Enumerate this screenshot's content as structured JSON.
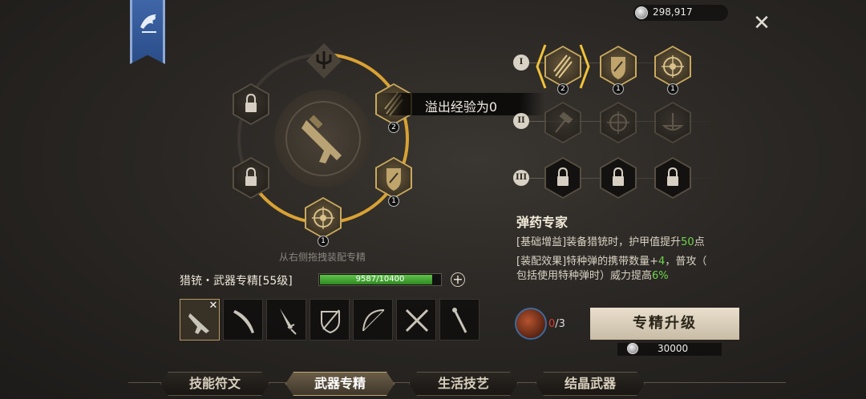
{
  "currency": {
    "icon": "silver-coin-icon",
    "value": "298,917"
  },
  "close_label": "✕",
  "ring": {
    "overflow_text": "溢出经验为0",
    "drag_hint": "从右侧拖拽装配专精",
    "slots": [
      {
        "id": "top",
        "icon": "trident-icon",
        "locked": false,
        "count": ""
      },
      {
        "id": "top-right",
        "icon": "arrows-icon",
        "locked": false,
        "count": "2"
      },
      {
        "id": "bottom-right",
        "icon": "shield-icon",
        "locked": false,
        "count": "1"
      },
      {
        "id": "bottom",
        "icon": "target-icon",
        "locked": false,
        "count": "1"
      },
      {
        "id": "bottom-left",
        "icon": "lock-icon",
        "locked": true
      },
      {
        "id": "top-left",
        "icon": "lock-icon",
        "locked": true
      }
    ]
  },
  "weapon": {
    "name": "猎铳・武器专精[55级]",
    "xp_text": "9587/10400",
    "xp_fraction": 0.9218,
    "plus_label": "+",
    "slots": [
      {
        "name": "rifle",
        "selected": true
      },
      {
        "name": "curved-sword",
        "selected": false
      },
      {
        "name": "dagger",
        "selected": false
      },
      {
        "name": "sword-shield",
        "selected": false
      },
      {
        "name": "bow",
        "selected": false
      },
      {
        "name": "dual-blades",
        "selected": false
      },
      {
        "name": "staff",
        "selected": false
      }
    ],
    "selected_remove_label": "✕"
  },
  "tiers": [
    {
      "label": "I",
      "skills": [
        {
          "icon": "arrows-icon",
          "count": "2",
          "selected": true
        },
        {
          "icon": "shield-icon",
          "count": "1"
        },
        {
          "icon": "target-icon",
          "count": "1"
        }
      ]
    },
    {
      "label": "II",
      "skills": [
        {
          "icon": "hammer-icon",
          "dim": true
        },
        {
          "icon": "crosshair-icon",
          "dim": true
        },
        {
          "icon": "scale-icon",
          "dim": true
        }
      ]
    },
    {
      "label": "III",
      "skills": [
        {
          "icon": "lock-icon",
          "locked": true
        },
        {
          "icon": "lock-icon",
          "locked": true
        },
        {
          "icon": "lock-icon",
          "locked": true
        }
      ]
    }
  ],
  "skill": {
    "title": "弹药专家",
    "line1_a": "[基础增益]装备猎铳时，护甲值提升",
    "line1_val": "50",
    "line1_b": "点",
    "line2_a": "[装配效果]特种弹的携带数量+",
    "line2_val": "4",
    "line2_b": "，普攻（",
    "line3_a": "包括使用特种弹时）威力提高",
    "line3_val": "6%"
  },
  "material": {
    "have": "0",
    "need": "/3"
  },
  "upgrade": {
    "label": "专精升级",
    "cost": "30000"
  },
  "tabs": [
    {
      "label": "技能符文",
      "active": false
    },
    {
      "label": "武器专精",
      "active": true
    },
    {
      "label": "生活技艺",
      "active": false
    },
    {
      "label": "结晶武器",
      "active": false
    }
  ],
  "colors": {
    "accent_gold": "#c9a95e",
    "xp_green": "#4fb83a",
    "highlight_green": "#6fd64b",
    "warn_red": "#e03a2e"
  }
}
